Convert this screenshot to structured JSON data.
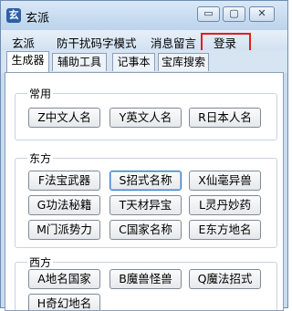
{
  "window": {
    "title": "玄派",
    "icon": "zen-logo-icon"
  },
  "title_controls": {
    "minimize": "▭",
    "maximize": "▢",
    "close": "✕"
  },
  "menu": [
    "玄派",
    "防干扰码字模式",
    "消息留言",
    "登录"
  ],
  "tabs": [
    "生成器",
    "辅助工具",
    "记事本",
    "宝库搜索"
  ],
  "groups": [
    {
      "title": "常用",
      "buttons": [
        "Z中文人名",
        "Y英文人名",
        "R日本人名"
      ]
    },
    {
      "title": "东方",
      "buttons": [
        "F法宝武器",
        "S招式名称",
        "X仙毫异兽",
        "G功法秘籍",
        "T天材异宝",
        "L灵丹妙药",
        "M门派势力",
        "C国家名称",
        "E东方地名"
      ]
    },
    {
      "title": "西方",
      "buttons": [
        "A地名国家",
        "B魔兽怪兽",
        "Q魔法招式",
        "H奇幻地名"
      ]
    }
  ],
  "colors": {
    "highlight_box": "#e0201e",
    "accent": "#3a79c2"
  }
}
